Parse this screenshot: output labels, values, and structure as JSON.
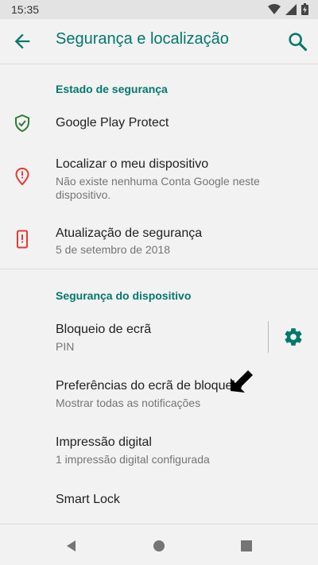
{
  "status_bar": {
    "time": "15:35",
    "icons": [
      "wifi-icon",
      "signal-icon",
      "battery-icon"
    ]
  },
  "toolbar": {
    "title": "Segurança e localização",
    "back_icon": "arrow-back-icon",
    "search_icon": "search-icon"
  },
  "sections": [
    {
      "header": "Estado de segurança",
      "items": [
        {
          "title": "Google Play Protect",
          "subtitle": "",
          "icon": "shield-check-icon"
        },
        {
          "title": "Localizar o meu dispositivo",
          "subtitle": "Não existe nenhuma Conta Google neste dispositivo.",
          "icon": "location-alert-icon"
        },
        {
          "title": "Atualização de segurança",
          "subtitle": "5 de setembro de 2018",
          "icon": "phone-alert-icon"
        }
      ]
    },
    {
      "header": "Segurança do dispositivo",
      "items": [
        {
          "title": "Bloqueio de ecrã",
          "subtitle": "PIN",
          "icon": "gear-icon"
        },
        {
          "title": "Preferências do ecrã de bloqueio",
          "subtitle": "Mostrar todas as notificações"
        },
        {
          "title": "Impressão digital",
          "subtitle": "1 impressão digital configurada"
        },
        {
          "title": "Smart Lock",
          "subtitle": ""
        }
      ]
    }
  ],
  "nav_bar": {
    "buttons": [
      "back-triangle-icon",
      "home-circle-icon",
      "recents-square-icon"
    ]
  },
  "colors": {
    "accent": "#00796b",
    "protect_green": "#2e7d32",
    "alert_red": "#e53935",
    "background": "#f2f2f2"
  }
}
